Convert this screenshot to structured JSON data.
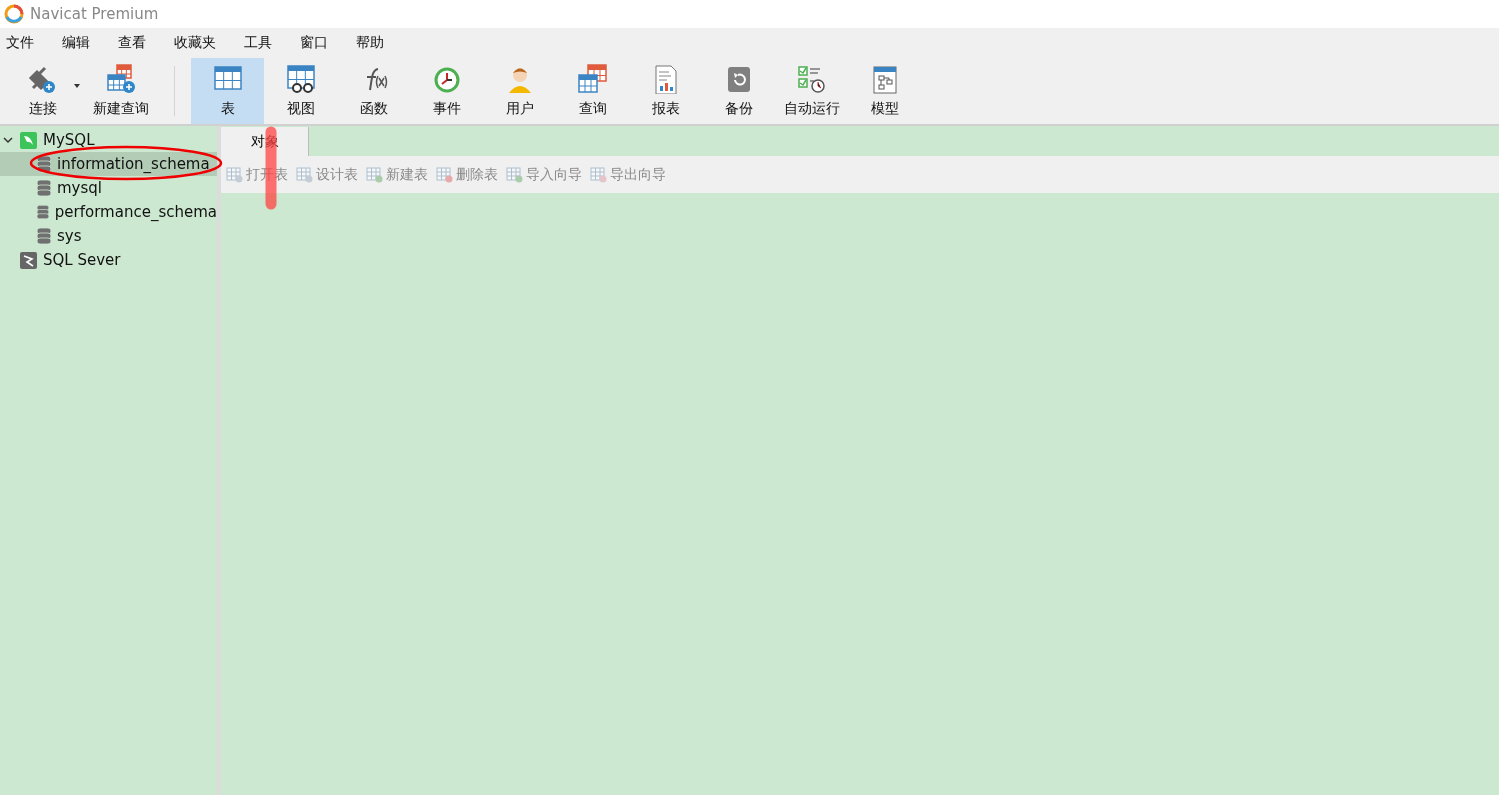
{
  "window": {
    "title": "Navicat Premium"
  },
  "menu": [
    "文件",
    "编辑",
    "查看",
    "收藏夹",
    "工具",
    "窗口",
    "帮助"
  ],
  "toolbar": {
    "left": [
      {
        "label": "连接",
        "dropdown": true
      },
      {
        "label": "新建查询"
      }
    ],
    "objects": [
      {
        "label": "表",
        "selected": true
      },
      {
        "label": "视图",
        "selected": false
      },
      {
        "label": "函数",
        "selected": false
      },
      {
        "label": "事件",
        "selected": false
      },
      {
        "label": "用户",
        "selected": false
      },
      {
        "label": "查询",
        "selected": false
      },
      {
        "label": "报表",
        "selected": false
      },
      {
        "label": "备份",
        "selected": false
      },
      {
        "label": "自动运行",
        "selected": false
      },
      {
        "label": "模型",
        "selected": false
      }
    ]
  },
  "sidebar": {
    "items": [
      {
        "label": "MySQL",
        "kind": "mysql",
        "expanded": true,
        "selected": false,
        "children": [
          {
            "label": "information_schema",
            "kind": "database",
            "selected": true
          },
          {
            "label": "mysql",
            "kind": "database",
            "selected": false
          },
          {
            "label": "performance_schema",
            "kind": "database",
            "selected": false
          },
          {
            "label": "sys",
            "kind": "database",
            "selected": false
          }
        ]
      },
      {
        "label": "SQL Sever",
        "kind": "sqlserver",
        "selected": false
      }
    ]
  },
  "tabs": [
    {
      "label": "对象",
      "selected": true
    }
  ],
  "actions": [
    {
      "label": "打开表",
      "disabled": true
    },
    {
      "label": "设计表",
      "disabled": true
    },
    {
      "label": "新建表",
      "disabled": true
    },
    {
      "label": "删除表",
      "disabled": true
    },
    {
      "label": "导入向导",
      "disabled": true
    },
    {
      "label": "导出向导",
      "disabled": true
    }
  ]
}
